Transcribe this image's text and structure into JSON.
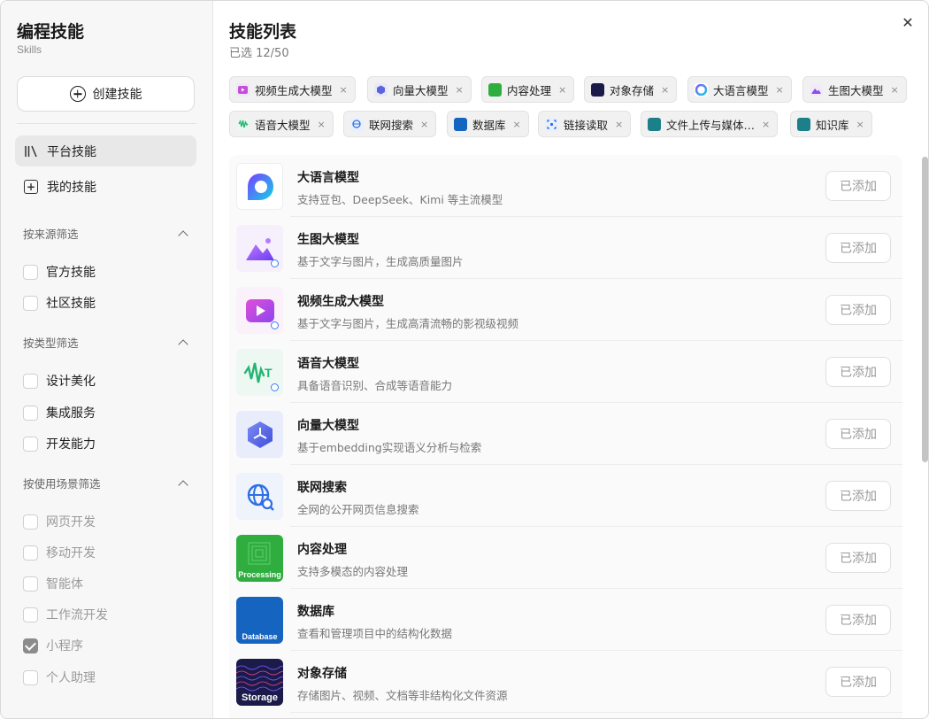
{
  "sidebar": {
    "title": "编程技能",
    "subtitle": "Skills",
    "create_label": "创建技能",
    "nav": [
      {
        "label": "平台技能",
        "icon": "library-icon",
        "active": true
      },
      {
        "label": "我的技能",
        "icon": "plus-square-icon",
        "active": false
      }
    ],
    "filters": {
      "source": {
        "title": "按来源筛选",
        "options": [
          {
            "label": "官方技能",
            "checked": false,
            "disabled": false
          },
          {
            "label": "社区技能",
            "checked": false,
            "disabled": false
          }
        ]
      },
      "type": {
        "title": "按类型筛选",
        "options": [
          {
            "label": "设计美化",
            "checked": false,
            "disabled": false
          },
          {
            "label": "集成服务",
            "checked": false,
            "disabled": false
          },
          {
            "label": "开发能力",
            "checked": false,
            "disabled": false
          }
        ]
      },
      "scene": {
        "title": "按使用场景筛选",
        "options": [
          {
            "label": "网页开发",
            "checked": false,
            "disabled": true
          },
          {
            "label": "移动开发",
            "checked": false,
            "disabled": true
          },
          {
            "label": "智能体",
            "checked": false,
            "disabled": true
          },
          {
            "label": "工作流开发",
            "checked": false,
            "disabled": true
          },
          {
            "label": "小程序",
            "checked": true,
            "disabled": true
          },
          {
            "label": "个人助理",
            "checked": false,
            "disabled": true
          }
        ]
      }
    }
  },
  "main": {
    "title": "技能列表",
    "selected_count": "已选 12/50",
    "chips": [
      {
        "label": "视频生成大模型",
        "icon": "video-icon",
        "color": "#f0e6f7"
      },
      {
        "label": "向量大模型",
        "icon": "cube-icon",
        "color": "#e7e9f8"
      },
      {
        "label": "内容处理",
        "icon": "processing-icon",
        "color": "#2fae3f"
      },
      {
        "label": "对象存储",
        "icon": "storage-icon",
        "color": "#1b1b4a"
      },
      {
        "label": "大语言模型",
        "icon": "llm-icon",
        "color": "#ffffff"
      },
      {
        "label": "生图大模型",
        "icon": "image-gen-icon",
        "color": "#f1ebf9"
      },
      {
        "label": "语音大模型",
        "icon": "audio-wave-icon",
        "color": "#eaf6ef"
      },
      {
        "label": "联网搜索",
        "icon": "globe-search-icon",
        "color": "#eaf0fb"
      },
      {
        "label": "数据库",
        "icon": "database-icon",
        "color": "#1565c0"
      },
      {
        "label": "链接读取",
        "icon": "link-scan-icon",
        "color": "#eaf0fb"
      },
      {
        "label": "文件上传与媒体…",
        "icon": "file-upload-icon",
        "color": "#1d7f8a"
      },
      {
        "label": "知识库",
        "icon": "knowledge-icon",
        "color": "#1d7f8a"
      }
    ],
    "chip_remove": "×",
    "skills": [
      {
        "name": "大语言模型",
        "desc": "支持豆包、DeepSeek、Kimi 等主流模型",
        "icon": "llm-icon",
        "button": "已添加"
      },
      {
        "name": "生图大模型",
        "desc": "基于文字与图片，生成高质量图片",
        "icon": "image-gen-icon",
        "button": "已添加"
      },
      {
        "name": "视频生成大模型",
        "desc": "基于文字与图片，生成高清流畅的影视级视频",
        "icon": "video-icon",
        "button": "已添加"
      },
      {
        "name": "语音大模型",
        "desc": "具备语音识别、合成等语音能力",
        "icon": "audio-wave-icon",
        "button": "已添加"
      },
      {
        "name": "向量大模型",
        "desc": "基于embedding实现语义分析与检索",
        "icon": "cube-icon",
        "button": "已添加"
      },
      {
        "name": "联网搜索",
        "desc": "全网的公开网页信息搜索",
        "icon": "globe-search-icon",
        "button": "已添加"
      },
      {
        "name": "内容处理",
        "desc": "支持多模态的内容处理",
        "icon": "processing-icon",
        "thumb_text": "Processing",
        "button": "已添加"
      },
      {
        "name": "数据库",
        "desc": "查看和管理项目中的结构化数据",
        "icon": "database-icon",
        "thumb_text": "Database",
        "button": "已添加"
      },
      {
        "name": "对象存储",
        "desc": "存储图片、视频、文档等非结构化文件资源",
        "icon": "storage-icon",
        "thumb_text": "Storage",
        "button": "已添加"
      }
    ]
  },
  "colors": {
    "accent": "#3b7cf5",
    "sidebar_bg": "#f7f7f7",
    "list_bg": "#fafafa"
  }
}
